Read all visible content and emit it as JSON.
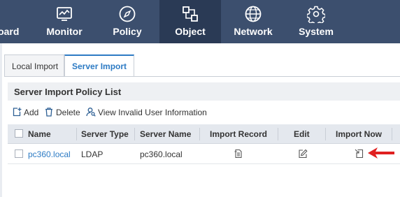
{
  "nav": {
    "items": [
      {
        "label": "board",
        "icon": "dashboard-icon"
      },
      {
        "label": "Monitor",
        "icon": "monitor-icon"
      },
      {
        "label": "Policy",
        "icon": "compass-icon"
      },
      {
        "label": "Object",
        "icon": "object-icon",
        "active": true
      },
      {
        "label": "Network",
        "icon": "globe-icon"
      },
      {
        "label": "System",
        "icon": "gear-icon"
      }
    ]
  },
  "tabs": [
    {
      "label": "Local Import"
    },
    {
      "label": "Server Import",
      "active": true
    }
  ],
  "panel": {
    "title": "Server Import Policy List"
  },
  "toolbar": {
    "add_label": "Add",
    "delete_label": "Delete",
    "view_invalid_label": "View Invalid User Information"
  },
  "table": {
    "columns": [
      "Name",
      "Server Type",
      "Server Name",
      "Import Record",
      "Edit",
      "Import Now"
    ],
    "rows": [
      {
        "name": "pc360.local",
        "server_type": "LDAP",
        "server_name": "pc360.local",
        "import_record_icon": "document-icon",
        "edit_icon": "edit-icon",
        "import_now_icon": "import-icon"
      }
    ]
  },
  "colors": {
    "nav_bg": "#3c4f6e",
    "nav_active_bg": "#2a3a55",
    "accent": "#2d7bc4",
    "annotation_arrow": "#e02020"
  }
}
